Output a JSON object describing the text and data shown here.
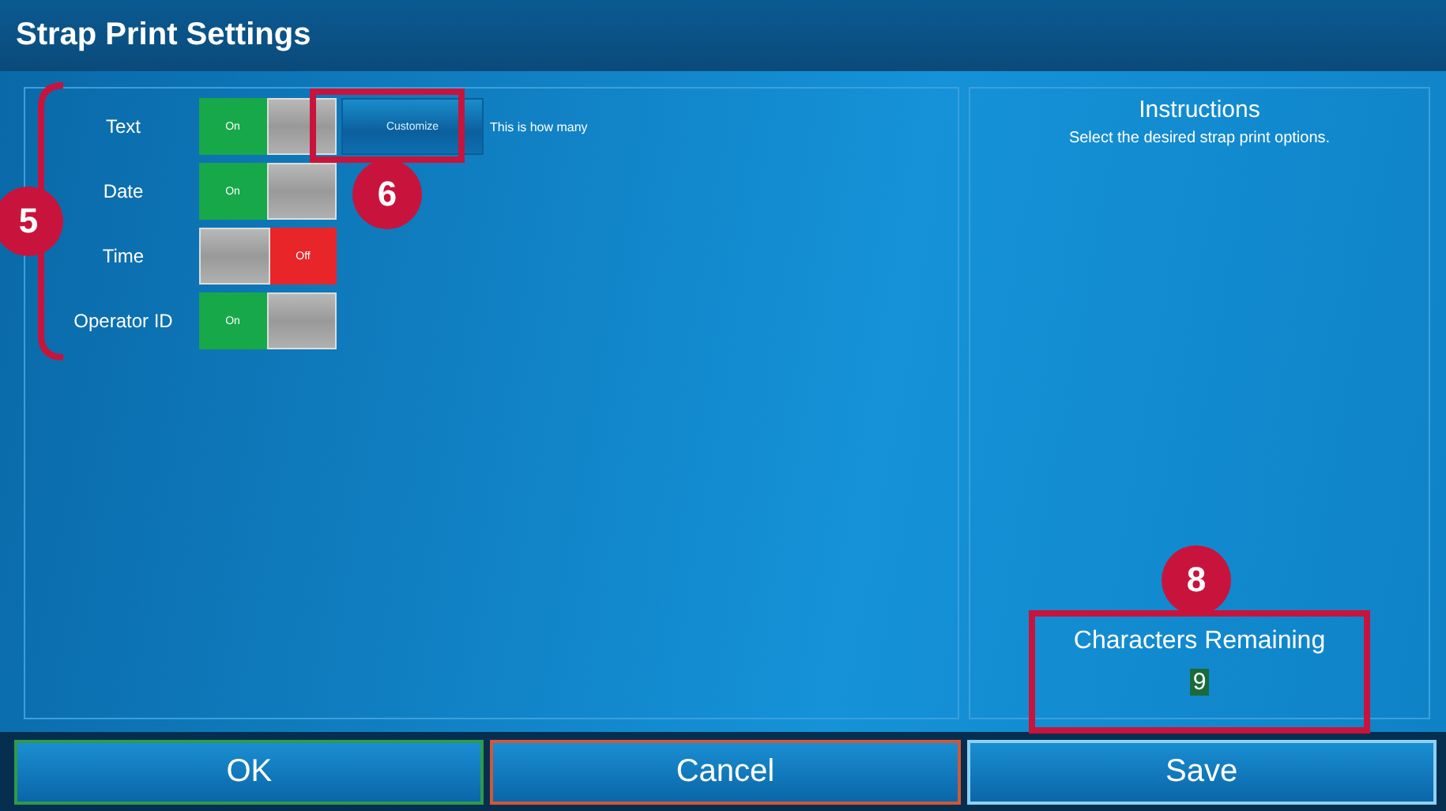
{
  "window": {
    "title": "Strap Print Settings"
  },
  "options": [
    {
      "label": "Text",
      "on": true,
      "state_label": "On"
    },
    {
      "label": "Date",
      "on": true,
      "state_label": "On"
    },
    {
      "label": "Time",
      "on": false,
      "state_label": "Off"
    },
    {
      "label": "Operator ID",
      "on": true,
      "state_label": "On"
    }
  ],
  "customize_button": "Customize",
  "customize_note": "This is how many",
  "instructions": {
    "title": "Instructions",
    "text": "Select the desired strap print options."
  },
  "characters": {
    "label": "Characters Remaining",
    "value": "9"
  },
  "buttons": [
    {
      "label": "OK",
      "color": "#2f9a4a"
    },
    {
      "label": "Cancel",
      "color": "#d0583a"
    },
    {
      "label": "Save",
      "color": "#8fd0f0"
    }
  ],
  "annotations": [
    {
      "kind": "bracket",
      "number": "5"
    },
    {
      "kind": "box",
      "number": "6"
    },
    {
      "kind": "box",
      "number": "8"
    }
  ]
}
